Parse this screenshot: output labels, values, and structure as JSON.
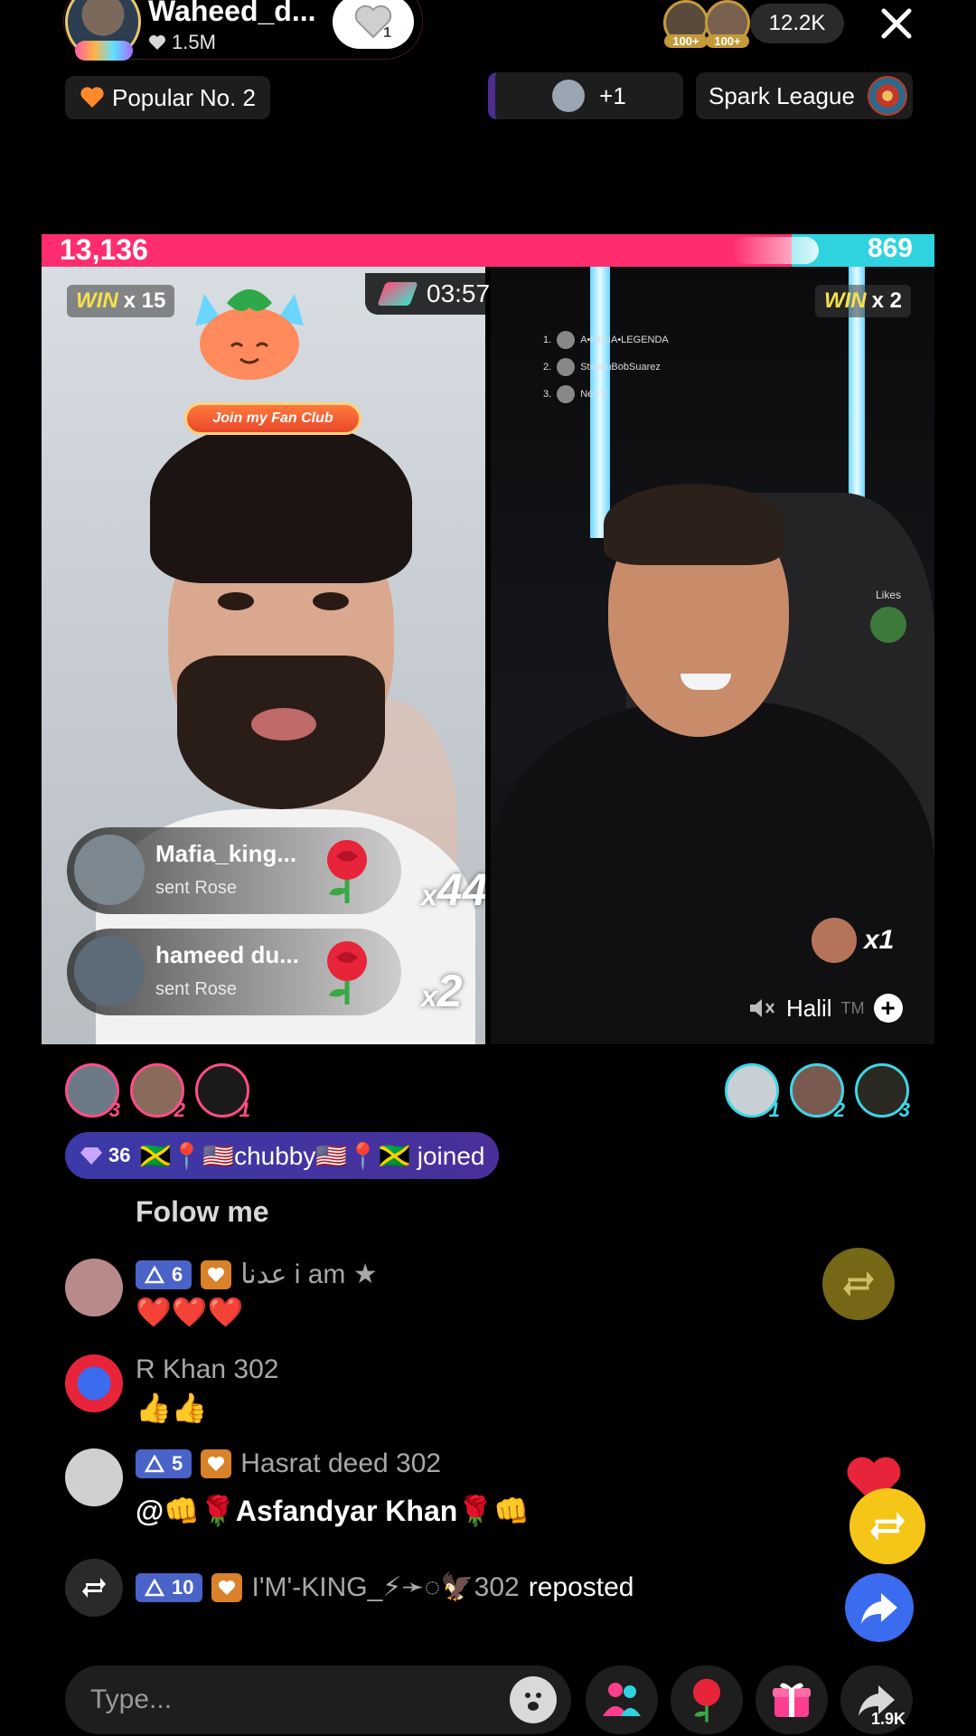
{
  "header": {
    "host_name": "Waheed_d...",
    "host_likes": "1.5M",
    "follow_count": "1",
    "viewer_badges": [
      "100+",
      "100+"
    ],
    "viewer_count": "12.2K",
    "popular_label": "Popular No. 2",
    "guest_count": "+1",
    "league_label": "Spark League"
  },
  "battle": {
    "score_left": "13,136",
    "score_right": "869",
    "timer": "03:57",
    "win_word": "WIN",
    "left_win_mult": "x 15",
    "right_win_mult": "x 2",
    "fan_club_label": "Join my Fan Club",
    "ranking": [
      {
        "rank": "1.",
        "name": "A•PENA•LEGENDA"
      },
      {
        "rank": "2.",
        "name": "StevenBobSuarez"
      },
      {
        "rank": "3.",
        "name": "Néo C"
      }
    ],
    "likes_widget": "Likes",
    "right_gift_mult": "x1",
    "right_host_name": "Halil",
    "right_host_suffix": "TM"
  },
  "gifts": [
    {
      "user": "Mafia_king...",
      "action": "sent Rose",
      "mult_x": "x",
      "mult_n": "44"
    },
    {
      "user": "hameed du...",
      "action": "sent Rose",
      "mult_x": "x",
      "mult_n": "2"
    }
  ],
  "supporters": {
    "left_ranks": [
      "3",
      "2",
      "1"
    ],
    "right_ranks": [
      "1",
      "2",
      "3"
    ]
  },
  "joined": {
    "level": "36",
    "text": "🇯🇲📍🇺🇸chubby🇺🇸📍🇯🇲 joined"
  },
  "chat": [
    {
      "user": "",
      "text": "Folow me"
    },
    {
      "level": "6",
      "user": "عدنا i am ★",
      "text": "❤️❤️❤️"
    },
    {
      "user": "R Khan  302",
      "text": "👍👍"
    },
    {
      "level": "5",
      "user": "Hasrat deed 302",
      "text": "@👊🌹Asfandyar Khan🌹👊"
    },
    {
      "level": "10",
      "user": "I'M'-KING_⚡➛◌🦅302",
      "text": "reposted"
    }
  ],
  "composer": {
    "placeholder": "Type...",
    "share_count": "1.9K"
  },
  "colors": {
    "team_left": "#ff2d6f",
    "team_right": "#2fd3e0",
    "win_yellow": "#f4e04d",
    "level_badge": "#4a63c9",
    "repost_yellow": "#f5c518"
  }
}
